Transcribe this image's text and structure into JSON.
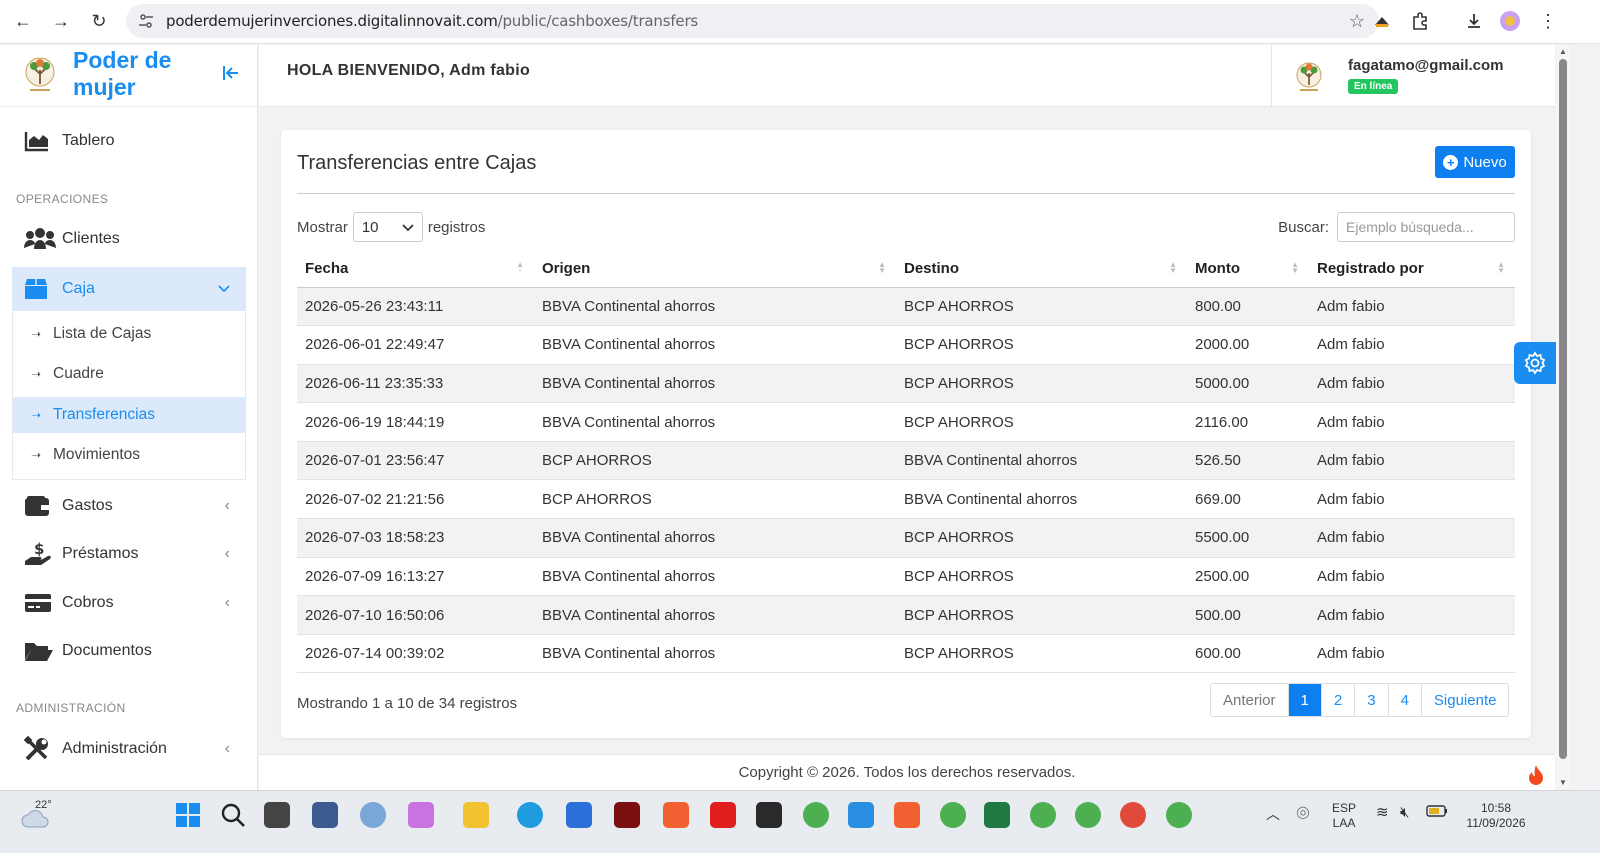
{
  "browser": {
    "url_host": "poderdemujerinverciones.digitalinnovait.com",
    "url_path": "/public/cashboxes/transfers"
  },
  "sidebar": {
    "brand": "Poder de mujer",
    "items": [
      {
        "label": "Tablero"
      },
      {
        "label": "Clientes"
      },
      {
        "label": "Caja"
      },
      {
        "label": "Gastos"
      },
      {
        "label": "Préstamos"
      },
      {
        "label": "Cobros"
      },
      {
        "label": "Documentos"
      },
      {
        "label": "Administración"
      }
    ],
    "sections": {
      "operaciones": "OPERACIONES",
      "administracion": "ADMINISTRACIÓN"
    },
    "caja_sub": [
      {
        "label": "Lista de Cajas"
      },
      {
        "label": "Cuadre"
      },
      {
        "label": "Transferencias"
      },
      {
        "label": "Movimientos"
      }
    ]
  },
  "header": {
    "greeting": "HOLA BIENVENIDO, Adm fabio",
    "user_email": "fagatamo@gmail.com",
    "status": "En línea"
  },
  "main": {
    "title": "Transferencias entre Cajas",
    "new_button": "Nuevo",
    "show_label": "Mostrar",
    "show_value": "10",
    "records_label": "registros",
    "search_label": "Buscar:",
    "search_placeholder": "Ejemplo búsqueda...",
    "columns": [
      "Fecha",
      "Origen",
      "Destino",
      "Monto",
      "Registrado por"
    ],
    "rows": [
      [
        "2026-05-26 23:43:11",
        "BBVA Continental ahorros",
        "BCP AHORROS",
        "800.00",
        "Adm fabio"
      ],
      [
        "2026-06-01 22:49:47",
        "BBVA Continental ahorros",
        "BCP AHORROS",
        "2000.00",
        "Adm fabio"
      ],
      [
        "2026-06-11 23:35:33",
        "BBVA Continental ahorros",
        "BCP AHORROS",
        "5000.00",
        "Adm fabio"
      ],
      [
        "2026-06-19 18:44:19",
        "BBVA Continental ahorros",
        "BCP AHORROS",
        "2116.00",
        "Adm fabio"
      ],
      [
        "2026-07-01 23:56:47",
        "BCP AHORROS",
        "BBVA Continental ahorros",
        "526.50",
        "Adm fabio"
      ],
      [
        "2026-07-02 21:21:56",
        "BCP AHORROS",
        "BBVA Continental ahorros",
        "669.00",
        "Adm fabio"
      ],
      [
        "2026-07-03 18:58:23",
        "BBVA Continental ahorros",
        "BCP AHORROS",
        "5500.00",
        "Adm fabio"
      ],
      [
        "2026-07-09 16:13:27",
        "BBVA Continental ahorros",
        "BCP AHORROS",
        "2500.00",
        "Adm fabio"
      ],
      [
        "2026-07-10 16:50:06",
        "BBVA Continental ahorros",
        "BCP AHORROS",
        "500.00",
        "Adm fabio"
      ],
      [
        "2026-07-14 00:39:02",
        "BBVA Continental ahorros",
        "BCP AHORROS",
        "600.00",
        "Adm fabio"
      ]
    ],
    "info": "Mostrando 1 a 10 de 34 registros",
    "pagination": {
      "prev": "Anterior",
      "pages": [
        "1",
        "2",
        "3",
        "4"
      ],
      "next": "Siguiente",
      "current": "1"
    }
  },
  "footer": {
    "text": "Copyright © 2026. Todos los derechos reservados."
  },
  "taskbar": {
    "temperature": "22°",
    "lang_1": "ESP",
    "lang_2": "LAA",
    "time": "10:58",
    "date": "11/09/2026"
  },
  "colors": {
    "accent": "#1a8df0",
    "primary_button": "#0d7ff0",
    "online": "#22c55e"
  }
}
